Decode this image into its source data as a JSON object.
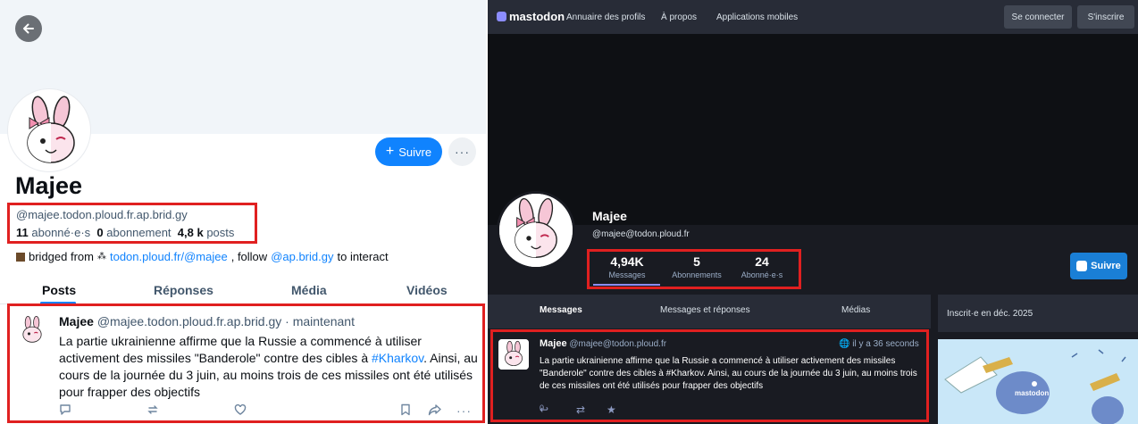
{
  "bluesky": {
    "name": "Majee",
    "handle": "@majee.todon.ploud.fr.ap.brid.gy",
    "followers_count": "11",
    "followers_label": "abonné·e·s",
    "following_count": "0",
    "following_label": "abonnement",
    "posts_count": "4,8 k",
    "posts_label": "posts",
    "follow_label": "Suivre",
    "bridge_text": "bridged from",
    "bridge_link": "todon.ploud.fr/@majee",
    "bridge_follow": ", follow",
    "bridge_account": "@ap.brid.gy",
    "bridge_tail": "to interact",
    "tabs": [
      {
        "label": "Posts"
      },
      {
        "label": "Réponses"
      },
      {
        "label": "Média"
      },
      {
        "label": "Vidéos"
      }
    ],
    "post": {
      "author": "Majee",
      "handle": "@majee.todon.ploud.fr.ap.brid.gy",
      "time": "· maintenant",
      "text_before": "La partie ukrainienne affirme que la Russie a commencé à utiliser activement des missiles \"Banderole\" contre des cibles à ",
      "hashtag": "#Kharkov",
      "text_after": ". Ainsi, au cours de la journée du 3 juin, au moins trois de ces missiles ont été utilisés pour frapper des objectifs"
    },
    "accent": "#1083fe"
  },
  "mastodon": {
    "logo_text": "mastodon",
    "nav": [
      {
        "label": "Annuaire des profils"
      },
      {
        "label": "À propos"
      },
      {
        "label": "Applications mobiles"
      }
    ],
    "login_label": "Se connecter",
    "signup_label": "S'inscrire",
    "name": "Majee",
    "handle": "@majee@todon.ploud.fr",
    "stats": [
      {
        "number": "4,94K",
        "label": "Messages"
      },
      {
        "number": "5",
        "label": "Abonnements"
      },
      {
        "number": "24",
        "label": "Abonné·e·s"
      }
    ],
    "follow_label": "Suivre",
    "tabs": [
      {
        "label": "Messages"
      },
      {
        "label": "Messages et réponses"
      },
      {
        "label": "Médias"
      }
    ],
    "joined": "Inscrit·e en déc. 2025",
    "illustration_text": "mastodon",
    "post": {
      "author": "Majee",
      "handle": "@majee@todon.ploud.fr",
      "time": "il y a 36 seconds",
      "text": "La partie ukrainienne affirme que la Russie a commencé à utiliser activement des missiles \"Banderole\" contre des cibles à #Kharkov. Ainsi, au cours de la journée du 3 juin, au moins trois de ces missiles ont été utilisés pour frapper des objectifs",
      "reply_count": "0"
    },
    "accent": "#8c8dff"
  }
}
